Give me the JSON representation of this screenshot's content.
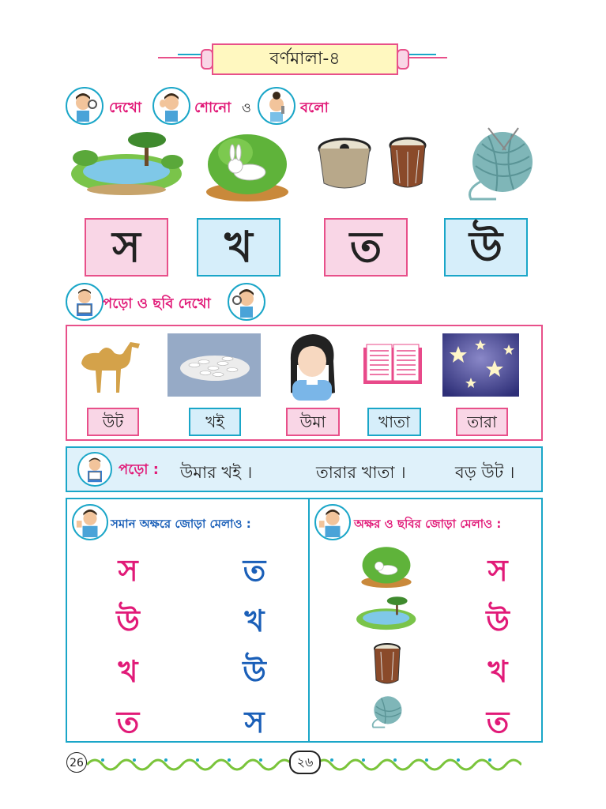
{
  "header": {
    "title": "বর্ণমালা-৪"
  },
  "instruction": {
    "see": "দেখো",
    "hear": "শোনো",
    "and": "ও",
    "say": "বলো"
  },
  "picture_row": {
    "images": [
      "pond-scene",
      "rabbit-in-bush",
      "tabla-drums",
      "yarn-ball"
    ]
  },
  "letters": [
    "স",
    "খ",
    "ত",
    "উ"
  ],
  "read_see": {
    "heading": "পড়ো ও ছবি দেখো",
    "words": [
      "উট",
      "খই",
      "উমা",
      "খাতা",
      "তারা"
    ]
  },
  "read_sentence": {
    "label": "পড়ো :",
    "s1": "উমার খই ।",
    "s2": "তারার খাতা ।",
    "s3": "বড় উট ।"
  },
  "match_same": {
    "heading": "সমান অক্ষরে জোড়া মেলাও :",
    "left": [
      "স",
      "উ",
      "খ",
      "ত"
    ],
    "right": [
      "ত",
      "খ",
      "উ",
      "স"
    ]
  },
  "match_picture": {
    "heading": "অক্ষর ও ছবির জোড়া মেলাও :",
    "right": [
      "স",
      "উ",
      "খ",
      "ত"
    ]
  },
  "footer": {
    "page_en": "26",
    "page_bn": "২৬"
  }
}
